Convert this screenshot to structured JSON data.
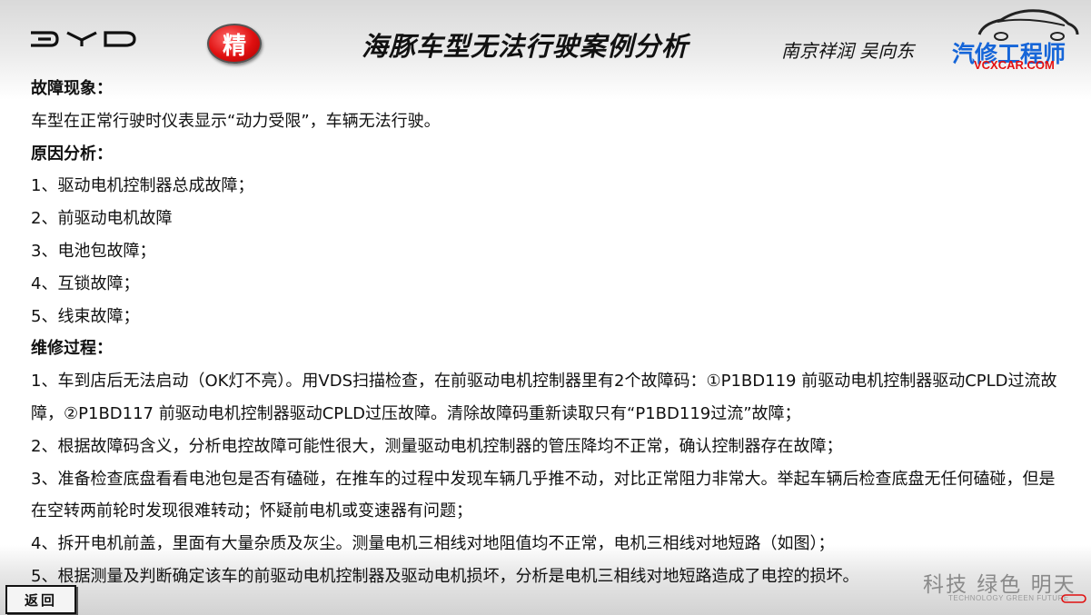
{
  "header": {
    "badge": "精",
    "title": "海豚车型无法行驶案例分析",
    "author": "南京祥润 吴向东",
    "brand_name": "汽修工程师",
    "brand_url": "VCXCAR.COM"
  },
  "sections": {
    "symptom_heading": "故障现象：",
    "symptom_text": "车型在正常行驶时仪表显示“动力受限”，车辆无法行驶。",
    "cause_heading": "原因分析：",
    "causes": [
      "1、驱动电机控制器总成故障；",
      "2、前驱动电机故障",
      "3、电池包故障；",
      "4、互锁故障；",
      "5、线束故障；"
    ],
    "repair_heading": "维修过程：",
    "steps": [
      "1、车到店后无法启动（OK灯不亮）。用VDS扫描检查，在前驱动电机控制器里有2个故障码：①P1BD119 前驱动电机控制器驱动CPLD过流故障，②P1BD117 前驱动电机控制器驱动CPLD过压故障。清除故障码重新读取只有“P1BD119过流”故障；",
      "2、根据故障码含义，分析电控故障可能性很大，测量驱动电机控制器的管压降均不正常，确认控制器存在故障；",
      "3、准备检查底盘看看电池包是否有磕碰，在推车的过程中发现车辆几乎推不动，对比正常阻力非常大。举起车辆后检查底盘无任何磕碰，但是在空转两前轮时发现很难转动；怀疑前电机或变速器有问题；",
      "4、拆开电机前盖，里面有大量杂质及灰尘。测量电机三相线对地阻值均不正常，电机三相线对地短路（如图）；",
      "5、根据测量及判断确定该车的前驱动电机控制器及驱动电机损坏，分析是电机三相线对地短路造成了电控的损坏。"
    ]
  },
  "footer": {
    "back_label": "返回",
    "slogan": "科技 绿色 明天",
    "slogan_sub": "TECHNOLOGY GREEN FUTURE"
  },
  "colors": {
    "accent_red": "#e01010",
    "brand_blue": "#1565d8"
  },
  "icons": {
    "byd_logo": "byd-logo-icon",
    "brand_car": "car-silhouette-icon"
  }
}
